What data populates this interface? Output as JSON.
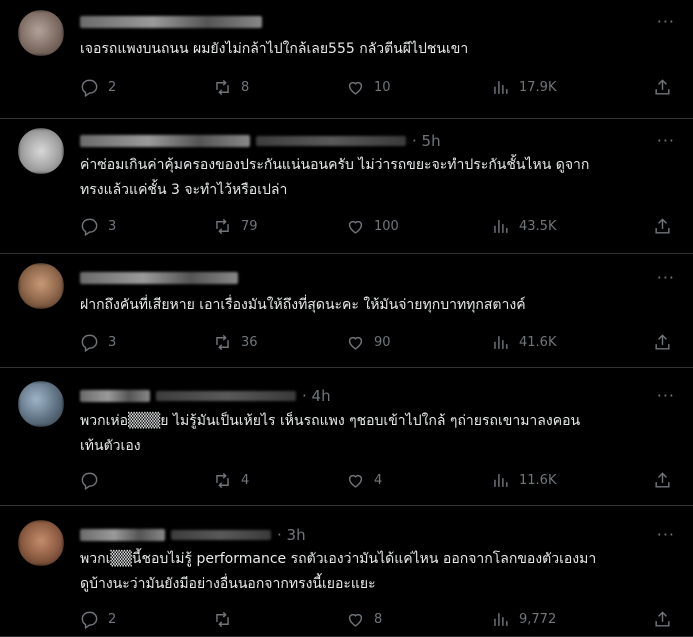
{
  "tweets": [
    {
      "time": "",
      "text": "เจอรถแพงบนถนน ผมยังไม่กล้าไปใกล้เลย555 กลัวตีนผีไปชนเขา",
      "replies": "2",
      "reposts": "8",
      "likes": "10",
      "views": "17.9K",
      "more": "···"
    },
    {
      "time": "· 5h",
      "text": "ค่าซ่อมเกินค่าคุ้มครองของประกันแน่นอนครับ ไม่ว่ารถขยะจะทำประกันชั้นไหน ดูจาก\nทรงแล้วแค่ชั้น 3 จะทำไว้หรือเปล่า",
      "replies": "3",
      "reposts": "79",
      "likes": "100",
      "views": "43.5K",
      "more": "···"
    },
    {
      "time": "",
      "text": "ฝากถึงคันที่เสียหาย เอาเรื่องมันให้ถึงที่สุดนะคะ ให้มันจ่ายทุกบาททุกสตางค์",
      "replies": "3",
      "reposts": "36",
      "likes": "90",
      "views": "41.6K",
      "more": "···"
    },
    {
      "time": "· 4h",
      "text": "พวกเห่อ▒▒▒ย ไม่รู้มันเป็นเห้ยไร เห็นรถแพง ๆชอบเข้าไปใกล้ ๆถ่ายรถเขามาลงคอน\nเท้นตัวเอง",
      "replies": "",
      "reposts": "4",
      "likes": "4",
      "views": "11.6K",
      "more": "···"
    },
    {
      "time": "· 3h",
      "text": "พวกเ▒▒นี้ชอบไม่รู้ performance รถตัวเองว่ามันได้แค่ไหน ออกจากโลกของตัวเองมา\nดูบ้างนะว่ามันยังมีอย่างอื่นนอกจากทรงนี้เยอะแยะ",
      "replies": "2",
      "reposts": "",
      "likes": "8",
      "views": "9,772",
      "more": "···"
    }
  ],
  "colors": {
    "bg": "#000000",
    "text": "#e7e9ea",
    "muted": "#71767b",
    "divider": "#2f3336"
  },
  "icons": [
    "reply-icon",
    "repost-icon",
    "like-icon",
    "views-icon",
    "share-icon"
  ]
}
